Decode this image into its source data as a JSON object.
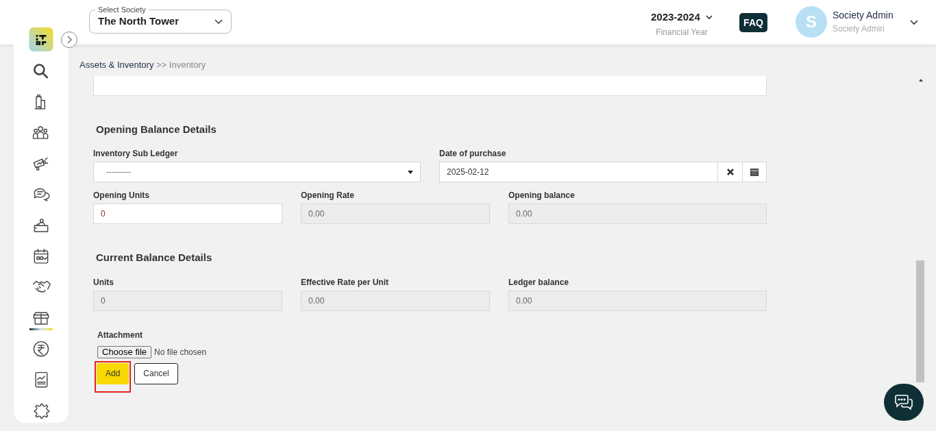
{
  "header": {
    "society_select": {
      "label": "Select Society",
      "value": "The North Tower"
    },
    "financial_year": {
      "value": "2023-2024",
      "caption": "Financial Year"
    },
    "faq": "FAQ",
    "user": {
      "initial": "S",
      "name": "Society Admin",
      "role": "Society Admin"
    }
  },
  "sidebar": {
    "items": [
      {
        "selected": false
      },
      {
        "selected": false
      },
      {
        "selected": false
      },
      {
        "selected": false
      },
      {
        "selected": false
      },
      {
        "selected": false
      },
      {
        "selected": false
      },
      {
        "selected": false
      },
      {
        "selected": true
      },
      {
        "selected": false
      },
      {
        "selected": false
      },
      {
        "selected": false
      }
    ]
  },
  "breadcrumb": {
    "parent": "Assets & Inventory",
    "separator": ">>",
    "current": "Inventory"
  },
  "sections": [
    {
      "title": "Opening Balance Details",
      "rows": [
        [
          {
            "kind": "select",
            "label": "Inventory Sub Ledger",
            "value": "---------"
          },
          {
            "kind": "date",
            "label": "Date of purchase",
            "value": "2025-02-12"
          }
        ],
        [
          {
            "kind": "input",
            "label": "Opening Units",
            "value": "0",
            "disabled": false
          },
          {
            "kind": "input",
            "label": "Opening Rate",
            "value": "0.00",
            "disabled": true
          },
          {
            "kind": "input",
            "label": "Opening balance",
            "value": "0.00",
            "disabled": true
          }
        ]
      ]
    },
    {
      "title": "Current Balance Details",
      "rows": [
        [
          {
            "kind": "input",
            "label": "Units",
            "value": "0",
            "disabled": true
          },
          {
            "kind": "input",
            "label": "Effective Rate per Unit",
            "value": "0.00",
            "disabled": true
          },
          {
            "kind": "input",
            "label": "Ledger balance",
            "value": "0.00",
            "disabled": true
          }
        ]
      ]
    }
  ],
  "attachment": {
    "label": "Attachment",
    "button": "Choose file",
    "status": "No file chosen"
  },
  "actions": [
    {
      "label": "Add",
      "kind": "primary",
      "highlighted": true
    },
    {
      "label": "Cancel",
      "kind": "secondary",
      "highlighted": false
    }
  ]
}
